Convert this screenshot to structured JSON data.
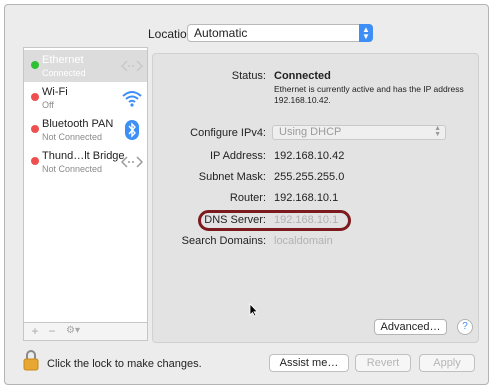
{
  "location": {
    "label": "Location:",
    "value": "Automatic"
  },
  "services": [
    {
      "name": "Ethernet",
      "status": "Connected",
      "dot_color": "#2fc133",
      "icon": "ethernet-arrows-icon"
    },
    {
      "name": "Wi-Fi",
      "status": "Off",
      "dot_color": "#ee4f4f",
      "icon": "wifi-icon"
    },
    {
      "name": "Bluetooth PAN",
      "status": "Not Connected",
      "dot_color": "#ee4f4f",
      "icon": "bluetooth-icon"
    },
    {
      "name": "Thund…lt Bridge",
      "status": "Not Connected",
      "dot_color": "#ee4f4f",
      "icon": "thunderbolt-arrows-icon"
    }
  ],
  "sidebar_footer": {
    "add": "+",
    "remove": "−",
    "action": "⚙▾"
  },
  "details": {
    "status_label": "Status:",
    "status_value": "Connected",
    "status_desc": "Ethernet is currently active and has the IP address 192.168.10.42.",
    "configure_label": "Configure IPv4:",
    "configure_value": "Using DHCP",
    "ip_label": "IP Address:",
    "ip_value": "192.168.10.42",
    "subnet_label": "Subnet Mask:",
    "subnet_value": "255.255.255.0",
    "router_label": "Router:",
    "router_value": "192.168.10.1",
    "dns_label": "DNS Server:",
    "dns_value": "192.168.10.1",
    "search_label": "Search Domains:",
    "search_value": "localdomain",
    "advanced": "Advanced…",
    "help": "?"
  },
  "footer": {
    "lock_text": "Click the lock to make changes.",
    "assist": "Assist me…",
    "revert": "Revert",
    "apply": "Apply"
  },
  "colors": {
    "accent": "#3d8ff6",
    "highlight_ring": "#7d1a1d",
    "connected": "#2fc133",
    "disconnected": "#ee4f4f"
  }
}
